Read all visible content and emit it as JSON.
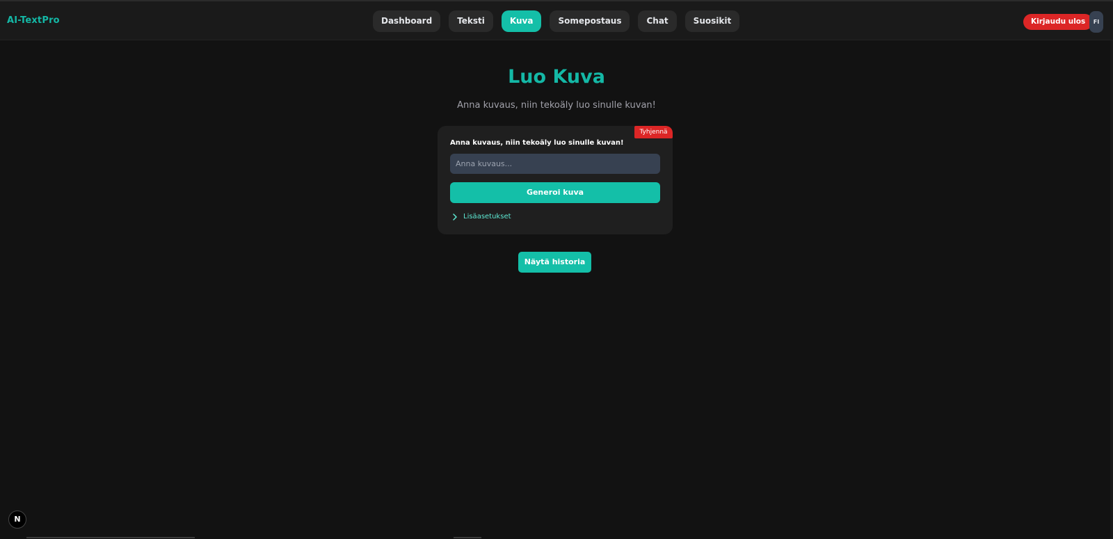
{
  "app": {
    "name": "AI-TextPro"
  },
  "nav": {
    "tabs": [
      {
        "label": "Dashboard",
        "active": false
      },
      {
        "label": "Teksti",
        "active": false
      },
      {
        "label": "Kuva",
        "active": true
      },
      {
        "label": "Somepostaus",
        "active": false
      },
      {
        "label": "Chat",
        "active": false
      },
      {
        "label": "Suosikit",
        "active": false
      }
    ],
    "logout_label": "Kirjaudu ulos",
    "language": "FI"
  },
  "page": {
    "title": "Luo Kuva",
    "subtitle": "Anna kuvaus, niin tekoäly luo sinulle kuvan!"
  },
  "form": {
    "clear_label": "Tyhjennä",
    "field_label": "Anna kuvaus, niin tekoäly luo sinulle kuvan!",
    "input_value": "",
    "input_placeholder": "Anna kuvaus...",
    "generate_label": "Generoi kuva",
    "advanced_label": "Lisäasetukset"
  },
  "history": {
    "button_label": "Näytä historia"
  },
  "dev_badge": {
    "letter": "N"
  },
  "colors": {
    "accent": "#14bfa8",
    "danger": "#dc2626",
    "background": "#121212",
    "navbar": "#1a1a1a",
    "card": "#1f1f1f"
  },
  "icons": {
    "advanced_toggle": "chevron-right-icon",
    "dev_badge": "nextjs-logo-icon"
  }
}
